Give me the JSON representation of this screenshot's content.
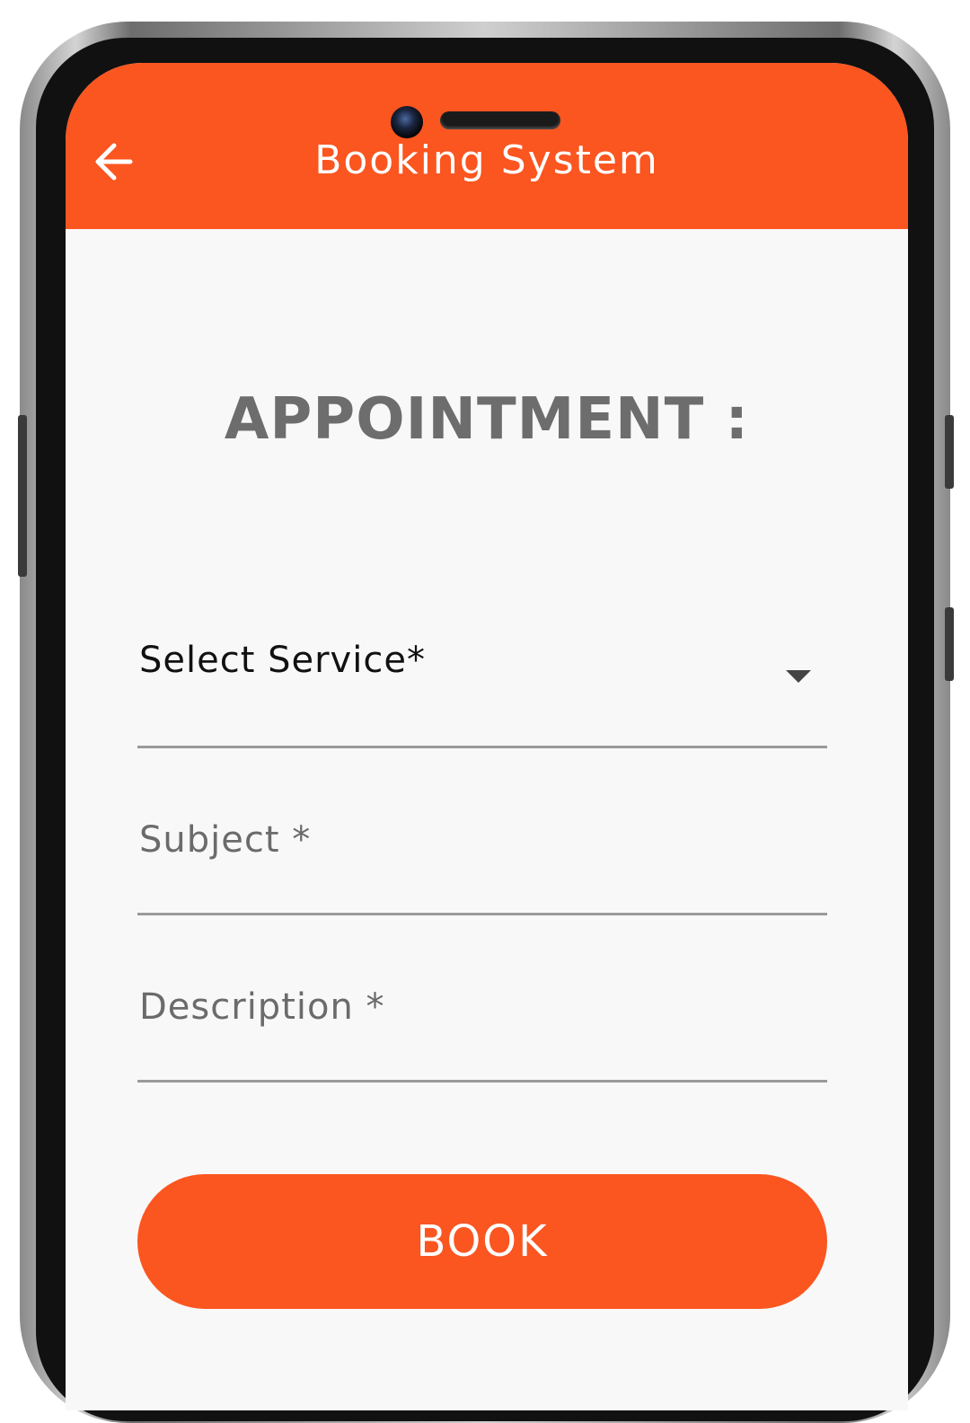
{
  "app_bar": {
    "title": "Booking System",
    "back_icon": "arrow-left-icon",
    "color": "#fb5520"
  },
  "form": {
    "heading": "APPOINTMENT :",
    "service_label": "Select Service*",
    "subject_label": "Subject *",
    "description_label": "Description *",
    "dropdown_icon": "caret-down-icon"
  },
  "actions": {
    "book_label": "BOOK"
  },
  "colors": {
    "accent": "#fb5520",
    "heading": "#6d6d6d",
    "background": "#f8f8f8"
  }
}
